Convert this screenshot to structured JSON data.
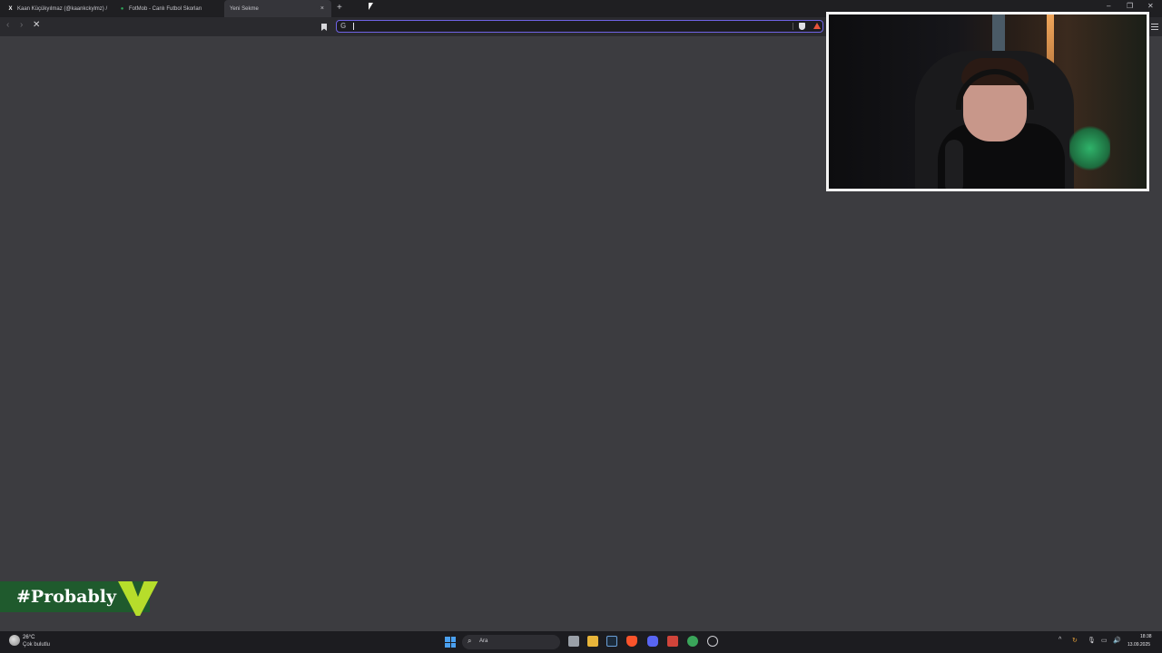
{
  "tabs": [
    {
      "label": "Kaan Küçükyılmaz (@kaankckylmz) /",
      "icon": "x-logo-icon"
    },
    {
      "label": "FotMob - Canlı Futbol Skorları",
      "icon": "fotmob-icon"
    },
    {
      "label": "Yeni Sekme",
      "icon": "none",
      "active": true
    }
  ],
  "new_tab_symbol": "+",
  "tab_close_symbol": "×",
  "window_controls": {
    "minimize": "–",
    "maximize": "❐",
    "close": "✕"
  },
  "toolbar": {
    "back": "‹",
    "forward": "›",
    "stop": "✕"
  },
  "address_bar": {
    "search_engine_glyph": "G",
    "value": "",
    "placeholder": ""
  },
  "overlay": {
    "brand_text": "#Probably"
  },
  "taskbar": {
    "weather_temp": "26°C",
    "weather_desc": "Çok bulutlu",
    "search_label": "Ara",
    "tray_up": "^",
    "time": "18:38",
    "date": "13.09.2025"
  },
  "colors": {
    "accent": "#6f63e6",
    "brand_green": "#1f5a2d",
    "brand_lime": "#b6dd2b"
  }
}
